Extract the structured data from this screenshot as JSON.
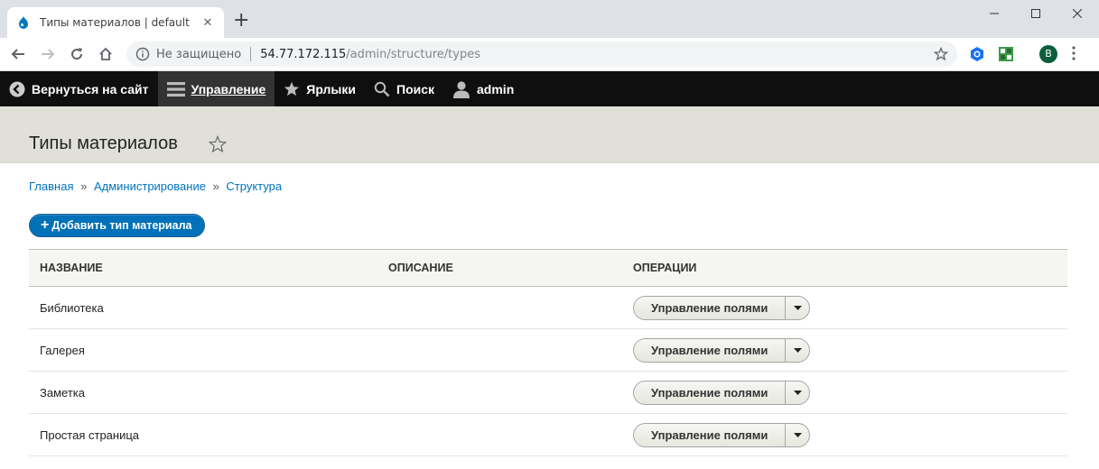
{
  "browser": {
    "tab_title": "Типы материалов | default",
    "tab_close": "✕",
    "new_tab": "+",
    "security_label": "Не защищено",
    "url_host": "54.77.172.115",
    "url_path": "/admin/structure/types",
    "profile_initial": "B"
  },
  "admin_toolbar": {
    "items": [
      {
        "label": "Вернуться на сайт",
        "icon": "back-circle-icon"
      },
      {
        "label": "Управление",
        "icon": "hamburger-icon"
      },
      {
        "label": "Ярлыки",
        "icon": "star-icon"
      },
      {
        "label": "Поиск",
        "icon": "search-icon"
      },
      {
        "label": "admin",
        "icon": "user-icon"
      }
    ]
  },
  "page": {
    "title": "Типы материалов",
    "breadcrumb": [
      "Главная",
      "Администрирование",
      "Структура"
    ],
    "breadcrumb_sep": "»",
    "add_button": "Добавить тип материала",
    "add_button_plus": "+"
  },
  "table": {
    "headers": [
      "Название",
      "Описание",
      "Операции"
    ],
    "rows": [
      {
        "name": "Библиотека",
        "description": "",
        "operation": "Управление полями"
      },
      {
        "name": "Галерея",
        "description": "",
        "operation": "Управление полями"
      },
      {
        "name": "Заметка",
        "description": "",
        "operation": "Управление полями"
      },
      {
        "name": "Простая страница",
        "description": "",
        "operation": "Управление полями"
      }
    ]
  },
  "colors": {
    "admin_toolbar_bg": "#0f0f0f",
    "link": "#0074bd",
    "primary_button": "#0071b8",
    "page_header_bg": "#e0e0d8"
  }
}
